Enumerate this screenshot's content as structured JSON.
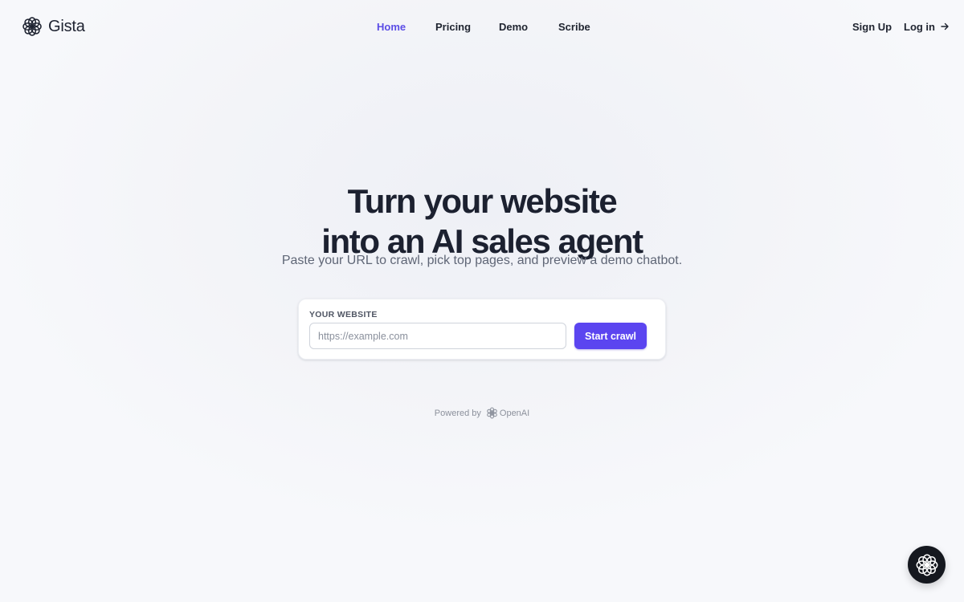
{
  "brand": {
    "name": "Gista",
    "logo_icon": "flower-logo-icon"
  },
  "nav": {
    "items": [
      {
        "label": "Home",
        "active": true
      },
      {
        "label": "Pricing",
        "active": false
      },
      {
        "label": "Demo",
        "active": false
      },
      {
        "label": "Scribe",
        "active": false
      }
    ],
    "signup_label": "Sign Up",
    "login_label": "Log in",
    "login_icon": "arrow-right-icon"
  },
  "hero": {
    "title_line1": "Turn your website",
    "title_line2": "into an AI sales agent",
    "subtitle": "Paste your URL to crawl, pick top pages, and preview a demo chatbot."
  },
  "crawl_form": {
    "label": "YOUR WEBSITE",
    "placeholder": "https://example.com",
    "value": "",
    "button_label": "Start crawl"
  },
  "footer": {
    "powered_by": "Powered by",
    "provider": "OpenAI",
    "provider_icon": "openai-icon"
  },
  "chat_launcher": {
    "icon": "flower-logo-icon"
  },
  "colors": {
    "accent": "#5b45f0",
    "nav_active": "#5b4de6",
    "launcher_bg": "#15181f"
  }
}
